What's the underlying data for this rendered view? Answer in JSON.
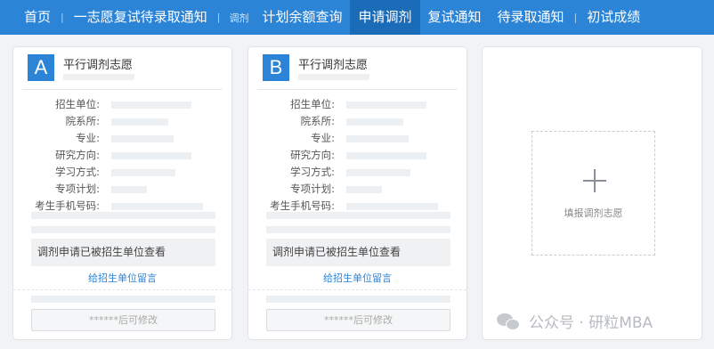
{
  "nav": {
    "home": "首页",
    "first_choice": "一志愿复试待录取通知",
    "tag": "调剂",
    "quota": "计划余额查询",
    "apply": "申请调剂",
    "retest": "复试通知",
    "pending": "待录取通知",
    "scores": "初试成绩"
  },
  "cards": [
    {
      "letter": "A",
      "title": "平行调剂志愿",
      "labels": [
        "招生单位:",
        "院系所:",
        "专业:",
        "研究方向:",
        "学习方式:",
        "专项计划:",
        "考生手机号码:"
      ],
      "notice": "调剂申请已被招生单位查看",
      "message_link": "给招生单位留言",
      "modify_text": "******后可修改"
    },
    {
      "letter": "B",
      "title": "平行调剂志愿",
      "labels": [
        "招生单位:",
        "院系所:",
        "专业:",
        "研究方向:",
        "学习方式:",
        "专项计划:",
        "考生手机号码:"
      ],
      "notice": "调剂申请已被招生单位查看",
      "message_link": "给招生单位留言",
      "modify_text": "******后可修改"
    }
  ],
  "add_card": {
    "label": "填报调剂志愿",
    "icon": "plus-icon"
  },
  "watermark": {
    "text": "公众号 · 研粒MBA",
    "icon": "wechat-icon"
  },
  "colors": {
    "primary": "#2b84d6",
    "active_tab": "#1a6bb8",
    "link": "#2b84d6"
  }
}
